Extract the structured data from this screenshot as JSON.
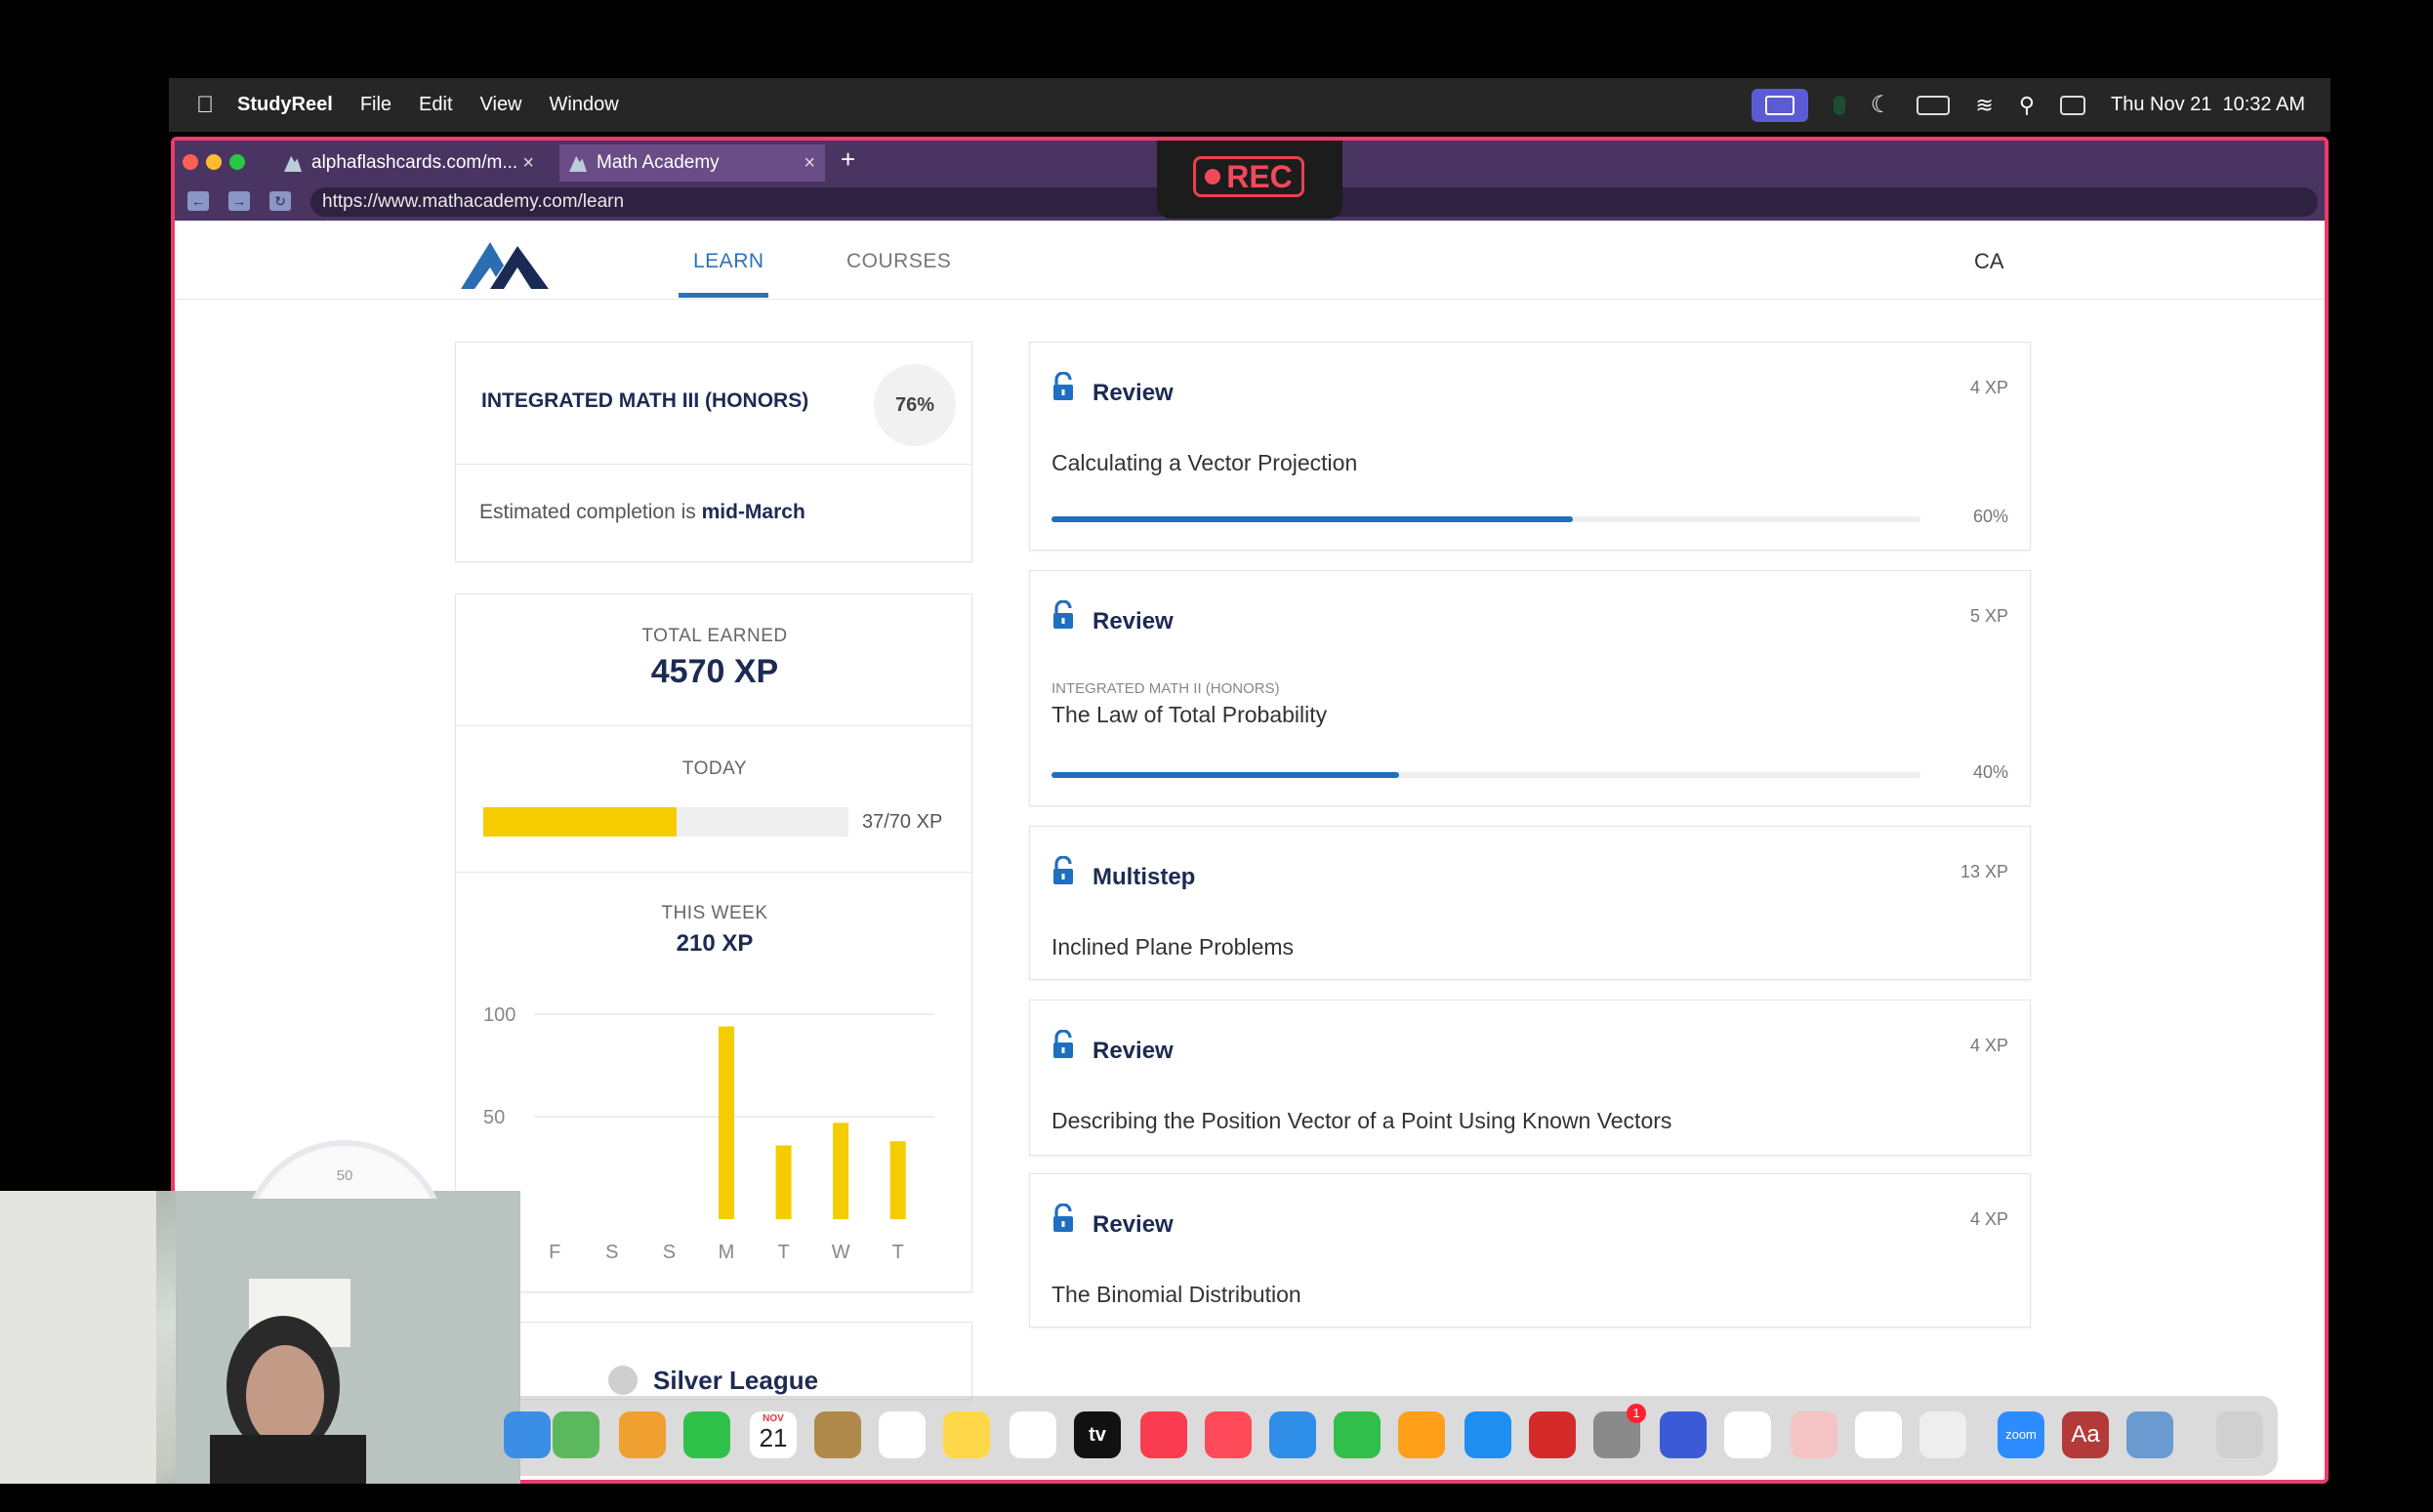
{
  "menubar": {
    "app": "StudyReel",
    "menus": [
      "File",
      "Edit",
      "View",
      "Window"
    ],
    "clock": "Thu Nov 21  10:32 AM"
  },
  "browser": {
    "tabs": [
      {
        "label": "alphaflashcards.com/m..."
      },
      {
        "label": "Math Academy"
      }
    ],
    "new_tab": "+",
    "url": "https://www.mathacademy.com/learn",
    "rec_label": "REC"
  },
  "nav": {
    "learn": "LEARN",
    "courses": "COURSES",
    "avatar": "CA"
  },
  "course": {
    "name": "INTEGRATED MATH III (HONORS)",
    "percent": "76%",
    "completion_prefix": "Estimated completion is ",
    "completion_value": "mid-March"
  },
  "xp": {
    "total_label": "TOTAL EARNED",
    "total_value": "4570 XP",
    "today_label": "TODAY",
    "today_value": "37/70 XP",
    "today_fraction": 0.53,
    "week_label": "THIS WEEK",
    "week_value": "210 XP"
  },
  "chart_data": {
    "type": "bar",
    "categories": [
      "F",
      "S",
      "S",
      "M",
      "T",
      "W",
      "T"
    ],
    "values": [
      0,
      0,
      0,
      94,
      36,
      47,
      38
    ],
    "ylim": [
      0,
      100
    ],
    "yticks": [
      "100",
      "50"
    ],
    "color": "#f5cc00",
    "gauge_label": "50"
  },
  "league": {
    "name": "Silver League"
  },
  "lessons": [
    {
      "type": "Review",
      "xp": "4 XP",
      "course": "",
      "title": "Calculating a Vector Projection",
      "progress": 0.6,
      "progress_label": "60%"
    },
    {
      "type": "Review",
      "xp": "5 XP",
      "course": "INTEGRATED MATH II (HONORS)",
      "title": "The Law of Total Probability",
      "progress": 0.4,
      "progress_label": "40%"
    },
    {
      "type": "Multistep",
      "xp": "13 XP",
      "course": "",
      "title": "Inclined Plane Problems",
      "progress": null,
      "progress_label": ""
    },
    {
      "type": "Review",
      "xp": "4 XP",
      "course": "",
      "title": "Describing the Position Vector of a Point Using Known Vectors",
      "progress": null,
      "progress_label": ""
    },
    {
      "type": "Review",
      "xp": "4 XP",
      "course": "",
      "title": "The Binomial Distribution",
      "progress": null,
      "progress_label": ""
    }
  ],
  "dock": {
    "calendar_month": "NOV",
    "calendar_day": "21",
    "tv_label": "tv",
    "zoom_label": "zoom",
    "dictionary_label": "Aa",
    "badge_count": "1"
  },
  "colors": {
    "accent_blue": "#1e6fc0",
    "nav_blue": "#2d72b8",
    "xp_yellow": "#f5cc00",
    "frame_pink": "#ec3c6b"
  }
}
